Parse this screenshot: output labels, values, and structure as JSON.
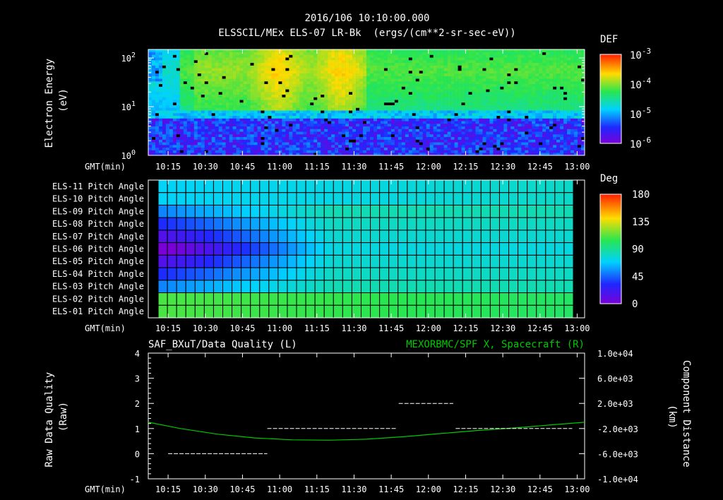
{
  "header": {
    "title": "2016/106 10:10:00.000",
    "subtitle": "ELSSCIL/MEx ELS-07 LR-Bk  (ergs/(cm**2-sr-sec-eV))"
  },
  "time_axis": {
    "label": "GMT(min)",
    "ticks": [
      "10:15",
      "10:30",
      "10:45",
      "11:00",
      "11:15",
      "11:30",
      "11:45",
      "12:00",
      "12:15",
      "12:30",
      "12:45",
      "13:00"
    ]
  },
  "chart_data": [
    {
      "type": "heatmap",
      "name": "energy-spectrogram",
      "ylabel": "Electron Energy\n(eV)",
      "yscale": "log",
      "ylim": [
        1,
        150
      ],
      "y_ticks": [
        1,
        10,
        100
      ],
      "colorbar": {
        "label": "DEF",
        "scale": "log",
        "range": [
          1e-06,
          0.001
        ],
        "tick_exponents": [
          -3,
          -4,
          -5,
          -6
        ]
      }
    },
    {
      "type": "heatmap",
      "name": "pitch-angle",
      "rows": [
        "ELS-11 Pitch Angle",
        "ELS-10 Pitch Angle",
        "ELS-09 Pitch Angle",
        "ELS-08 Pitch Angle",
        "ELS-07 Pitch Angle",
        "ELS-06 Pitch Angle",
        "ELS-05 Pitch Angle",
        "ELS-04 Pitch Angle",
        "ELS-03 Pitch Angle",
        "ELS-02 Pitch Angle",
        "ELS-01 Pitch Angle"
      ],
      "colorbar": {
        "label": "Deg",
        "range": [
          0,
          180
        ],
        "ticks": [
          180,
          135,
          90,
          45,
          0
        ]
      }
    },
    {
      "type": "line",
      "name": "data-quality-and-position",
      "title_left": "SAF_BXuT/Data Quality (L)",
      "title_right": "MEXORBMC/SPF X, Spacecraft (R)",
      "ylabel_left": "Raw Data Quality\n(Raw)",
      "ylabel_right": "Component Distance\n(km)",
      "ylim_left": [
        -1,
        4
      ],
      "y_ticks_left": [
        -1,
        0,
        1,
        2,
        3,
        4
      ],
      "ylim_right": [
        -10000,
        10000
      ],
      "y_ticks_right": [
        "1.0e+04",
        "6.0e+03",
        "2.0e+03",
        "-2.0e+03",
        "-6.0e+03",
        "-1.0e+04"
      ],
      "colors": {
        "quality": "#ffffff",
        "distance": "#00c800"
      },
      "series": [
        {
          "name": "SAF_BXuT/Data Quality",
          "axis": "left",
          "segments": [
            {
              "t_start": "10:15",
              "t_end": "10:55",
              "value": 0
            },
            {
              "t_start": "10:55",
              "t_end": "11:47",
              "value": 1
            },
            {
              "t_start": "11:48",
              "t_end": "12:10",
              "value": 2
            },
            {
              "t_start": "12:11",
              "t_end": "12:58",
              "value": 1
            }
          ]
        },
        {
          "name": "MEXORBMC/SPF X, Spacecraft",
          "axis": "right",
          "x": [
            "10:07",
            "10:20",
            "10:35",
            "10:50",
            "11:05",
            "11:20",
            "11:35",
            "11:50",
            "12:05",
            "12:20",
            "12:35",
            "12:50",
            "13:03"
          ],
          "y": [
            -1000,
            -2000,
            -2900,
            -3500,
            -3800,
            -3850,
            -3700,
            -3300,
            -2800,
            -2300,
            -1900,
            -1400,
            -1000
          ]
        }
      ]
    }
  ]
}
